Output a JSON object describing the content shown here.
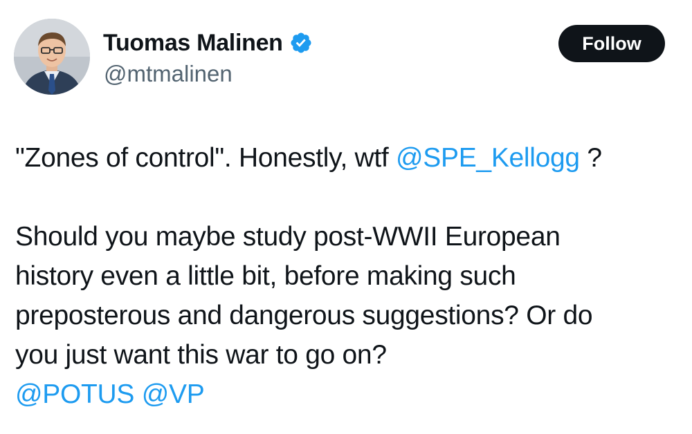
{
  "author": {
    "display_name": "Tuomas Malinen",
    "handle": "@mtmalinen",
    "verified": true,
    "avatar_icon": "profile-photo",
    "verified_icon": "verified-badge-icon",
    "verified_color": "#1d9bf0"
  },
  "follow_button": {
    "label": "Follow"
  },
  "tweet": {
    "line1_before": "\"Zones of control\". Honestly, wtf ",
    "line1_mention": "@SPE_Kellogg",
    "line1_after": " ?",
    "line2": "Should you maybe study post-WWII European",
    "line3": "history even a little bit, before making such",
    "line4": "preposterous and dangerous suggestions? Or do",
    "line5": "you just want this war to go on?",
    "mention_potus": "@POTUS",
    "mention_vp": "@VP"
  },
  "colors": {
    "link": "#1d9bf0",
    "text": "#0f1419",
    "secondary": "#536471",
    "button_bg": "#0f1419"
  }
}
